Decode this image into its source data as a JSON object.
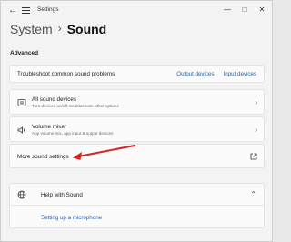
{
  "window": {
    "title": "Settings",
    "controls": {
      "minimize": "—",
      "maximize": "□",
      "close": "✕"
    }
  },
  "header": {
    "parent": "System",
    "separator": "›",
    "current": "Sound"
  },
  "advanced": {
    "section_label": "Advanced",
    "troubleshoot": {
      "label": "Troubleshoot common sound problems",
      "links": [
        "Output devices",
        "Input devices"
      ]
    },
    "items": [
      {
        "title": "All sound devices",
        "subtitle": "Turn devices on/off, troubleshoot, other options",
        "icon": "sound-devices-icon"
      },
      {
        "title": "Volume mixer",
        "subtitle": "App volume mix, app input & output devices",
        "icon": "volume-mixer-icon"
      }
    ],
    "more_settings": {
      "title": "More sound settings",
      "icon": "external-link-icon"
    }
  },
  "help": {
    "title": "Help with Sound",
    "link": "Setting up a microphone",
    "icon": "globe-icon"
  },
  "colors": {
    "accent": "#1f5fa6",
    "annotation_arrow": "#d42424"
  }
}
